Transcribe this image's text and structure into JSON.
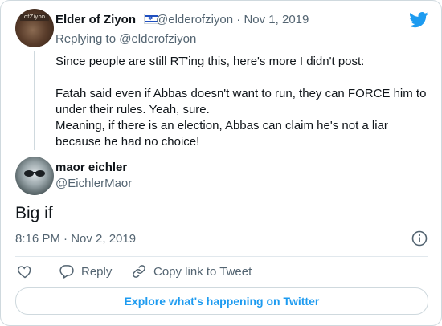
{
  "original_tweet": {
    "display_name": "Elder of Ziyon",
    "handle": "@elderofziyon",
    "separator": "·",
    "date": "Nov 1, 2019",
    "replying_to": "Replying to @elderofziyon",
    "avatar_text": "ofZiyon",
    "text": "Since people are still RT'ing this, here's more I didn't post:\n\nFatah said even if Abbas doesn't want to run, they can FORCE him to\nunder their rules. Yeah, sure.\nMeaning, if there is an election, Abbas can claim he's not a liar\nbecause he had no choice!"
  },
  "reply_tweet": {
    "display_name": "maor eichler",
    "handle": "@EichlerMaor",
    "text": "Big if",
    "timestamp": "8:16 PM · Nov 2, 2019"
  },
  "actions": {
    "like_label": "",
    "reply_label": "Reply",
    "copy_link_label": "Copy link to Tweet"
  },
  "explore_button": "Explore what's happening on Twitter",
  "colors": {
    "twitter_blue": "#1d9bf0",
    "text": "#0f1419",
    "secondary": "#536471",
    "border": "#cfd9de"
  },
  "icons": [
    "twitter-bird-icon",
    "israel-flag-icon",
    "info-icon",
    "heart-icon",
    "reply-icon",
    "link-icon"
  ]
}
